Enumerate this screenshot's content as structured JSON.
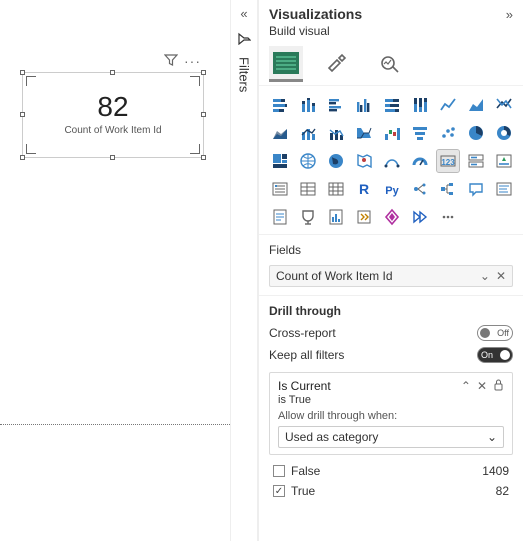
{
  "card": {
    "value": "82",
    "label": "Count of Work Item Id"
  },
  "filters_label": "Filters",
  "pane": {
    "title": "Visualizations",
    "build_label": "Build visual"
  },
  "fields": {
    "heading": "Fields",
    "item": "Count of Work Item Id"
  },
  "drill": {
    "heading": "Drill through",
    "cross_report": "Cross-report",
    "cross_report_state": "Off",
    "keep_all": "Keep all filters",
    "keep_all_state": "On",
    "field_name": "Is Current",
    "desc": "is True",
    "allow_label": "Allow drill through when:",
    "dropdown_value": "Used as category",
    "options": [
      {
        "checked": false,
        "label": "False",
        "count": "1409"
      },
      {
        "checked": true,
        "label": "True",
        "count": "82"
      }
    ]
  },
  "viz_icons": [
    "stacked-bar",
    "stacked-column",
    "grouped-bar",
    "grouped-column",
    "100-bar",
    "100-column",
    "line",
    "area",
    "ribbon",
    "area-stacked",
    "line-col",
    "line-col2",
    "ribbon-v",
    "waterfall",
    "funnel",
    "scatter",
    "pie",
    "donut",
    "treemap",
    "map",
    "filled-map",
    "map-shape",
    "map-arc",
    "gauge",
    "card-number",
    "multi-card",
    "kpi",
    "slicer",
    "table",
    "matrix",
    "r-visual",
    "python-visual",
    "key-influencers",
    "decomposition",
    "qna",
    "smart",
    "paginated",
    "goals",
    "metrics",
    "app",
    "power-app",
    "power-auto",
    "more"
  ]
}
